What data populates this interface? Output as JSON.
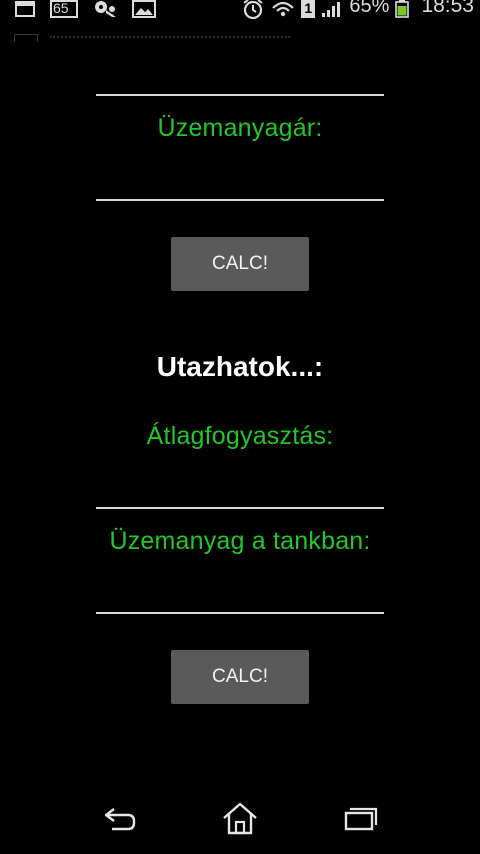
{
  "status_bar": {
    "badge_number": "65",
    "sim_slot": "1",
    "battery_percent": "65%",
    "time": "18:53",
    "icons": [
      "picture-icon",
      "message-badge-icon",
      "settings-bug-icon",
      "gallery-icon",
      "alarm-icon",
      "wifi-icon",
      "sim-icon",
      "signal-icon",
      "battery-icon"
    ],
    "battery_color": "#7cc62a"
  },
  "form": {
    "fuel_price_label": "Üzemanyagár:",
    "calc_button_1": "CALC!",
    "section_title": "Utazhatok...:",
    "avg_consumption_label": "Átlagfogyasztás:",
    "fuel_in_tank_label": "Üzemanyag a tankban:",
    "calc_button_2": "CALC!"
  },
  "colors": {
    "label_green": "#22c629",
    "button_gray": "#5a5a5a",
    "background": "#000000"
  },
  "nav_bar": {
    "icons": [
      "back-icon",
      "home-icon",
      "recent-apps-icon"
    ]
  }
}
